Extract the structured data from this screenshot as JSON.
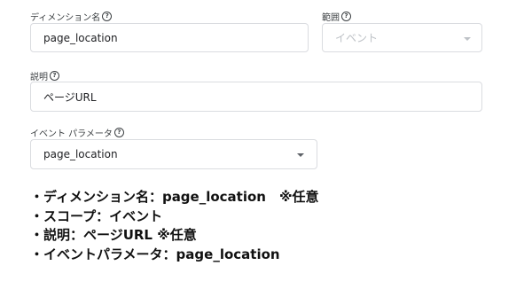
{
  "form": {
    "dimension_name": {
      "label": "ディメンション名",
      "value": "page_location"
    },
    "scope": {
      "label": "範囲",
      "value": "イベント",
      "disabled": true
    },
    "description": {
      "label": "説明",
      "value": "ページURL"
    },
    "event_parameter": {
      "label": "イベント パラメータ",
      "value": "page_location"
    },
    "help_icon_glyph": "?"
  },
  "notes": [
    "・ディメンション名：page_location　※任意",
    "・スコープ：イベント",
    "・説明：ページURL ※任意",
    "・イベントパラメータ：page_location"
  ],
  "icons": {
    "help": "help-circle-icon",
    "dropdown": "chevron-down-icon"
  }
}
